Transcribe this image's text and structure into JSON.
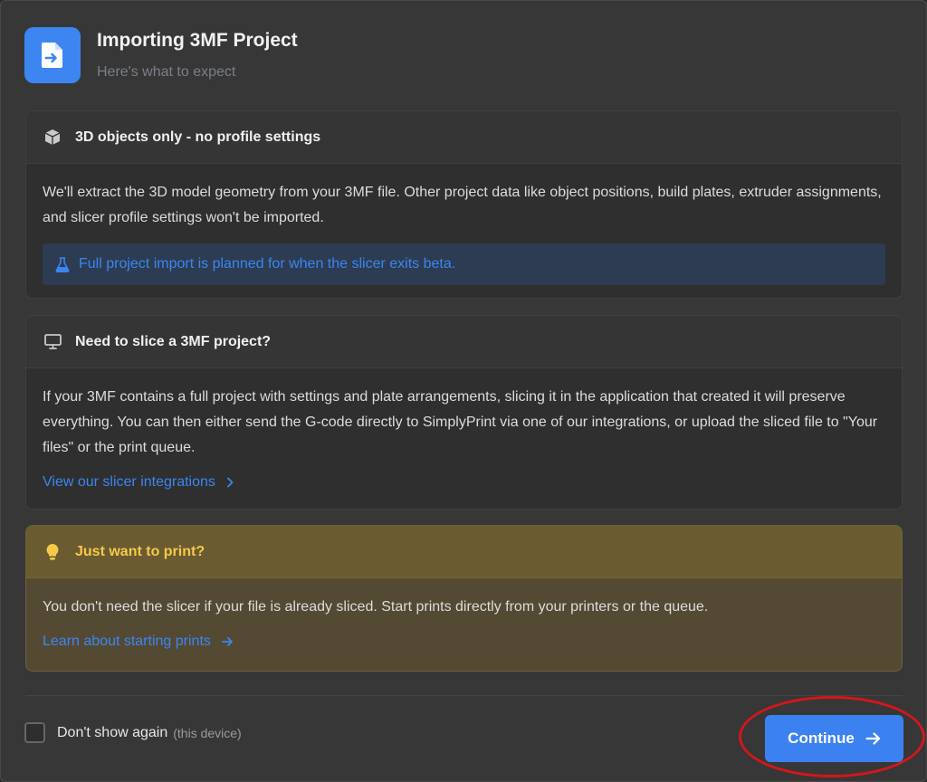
{
  "header": {
    "icon": "file-import-icon",
    "title": "Importing 3MF Project",
    "subtitle": "Here's what to expect"
  },
  "cards": {
    "objects": {
      "icon": "cube-icon",
      "title": "3D objects only - no profile settings",
      "body": "We'll extract the 3D model geometry from your 3MF file. Other project data like object positions, build plates, extruder assignments, and slicer profile settings won't be imported.",
      "info_icon": "flask-icon",
      "info": "Full project import is planned for when the slicer exits beta."
    },
    "slice": {
      "icon": "monitor-icon",
      "title": "Need to slice a 3MF project?",
      "body": "If your 3MF contains a full project with settings and plate arrangements, slicing it in the application that created it will preserve everything. You can then either send the G-code directly to SimplyPrint via one of our integrations, or upload the sliced file to \"Your files\" or the print queue.",
      "link": "View our slicer integrations",
      "link_icon": "chevron-right-icon"
    },
    "print": {
      "icon": "lightbulb-icon",
      "title": "Just want to print?",
      "body": "You don't need the slicer if your file is already sliced. Start prints directly from your printers or the queue.",
      "link": "Learn about starting prints",
      "link_icon": "arrow-right-icon"
    }
  },
  "footer": {
    "checkbox_label": "Don't show again",
    "checkbox_hint": "(this device)",
    "checked": false,
    "continue_label": "Continue",
    "continue_icon": "arrow-right-icon"
  },
  "colors": {
    "accent": "#3b82f0",
    "warning": "#f7c94a",
    "annotation": "#d4161c"
  }
}
